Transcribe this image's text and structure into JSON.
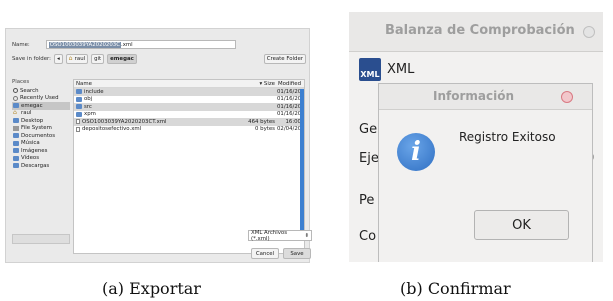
{
  "save_dialog": {
    "name_label": "Name:",
    "filename_selected": "OSO1003039YA2020203C",
    "filename_ext": ".xml",
    "save_in_label": "Save in folder:",
    "path_back": "◂",
    "path": [
      "raul",
      "git",
      "emegac"
    ],
    "create_folder": "Create Folder",
    "places_header": "Places",
    "places": [
      {
        "label": "Search",
        "icon": "search-icon"
      },
      {
        "label": "Recently Used",
        "icon": "clock-icon"
      },
      {
        "label": "emegac",
        "icon": "folder-icon",
        "selected": true
      },
      {
        "label": "raul",
        "icon": "home-icon"
      },
      {
        "label": "Desktop",
        "icon": "folder-icon"
      },
      {
        "label": "File System",
        "icon": "disk-icon"
      },
      {
        "label": "Documentos",
        "icon": "folder-icon"
      },
      {
        "label": "Música",
        "icon": "folder-icon"
      },
      {
        "label": "Imágenes",
        "icon": "folder-icon"
      },
      {
        "label": "Vídeos",
        "icon": "folder-icon"
      },
      {
        "label": "Descargas",
        "icon": "folder-icon"
      }
    ],
    "columns": {
      "name": "Name",
      "size": "Size",
      "modified": "Modified"
    },
    "files": [
      {
        "name": "include",
        "size": "",
        "modified": "01/16/20",
        "icon": "folder-icon"
      },
      {
        "name": "obj",
        "size": "",
        "modified": "01/16/20",
        "icon": "folder-icon"
      },
      {
        "name": "src",
        "size": "",
        "modified": "01/16/20",
        "icon": "folder-icon"
      },
      {
        "name": "xpm",
        "size": "",
        "modified": "01/16/20",
        "icon": "folder-icon"
      },
      {
        "name": "OSO1003039YA2020203CT.xml",
        "size": "464 bytes",
        "modified": "16:00",
        "icon": "file-icon"
      },
      {
        "name": "depositosefectivo.xml",
        "size": "0 bytes",
        "modified": "02/04/20",
        "icon": "file-icon"
      }
    ],
    "filter": "XML Archivos (*.xml)",
    "filter_arrow": "⬍",
    "cancel": "Cancel",
    "save": "Save"
  },
  "message_panel": {
    "window_title": "Balanza de Comprobación",
    "app_icon_text": "XML",
    "app_label": "XML",
    "bg_labels": [
      "Ge",
      "Eje",
      "Pe",
      "Co"
    ],
    "bg_value": "0",
    "dialog_title": "Información",
    "dialog_message": "Registro Exitoso",
    "info_glyph": "i",
    "ok": "OK",
    "close_color": "#e86a76"
  },
  "captions": {
    "a": "(a) Exportar",
    "b": "(b) Confirmar"
  }
}
